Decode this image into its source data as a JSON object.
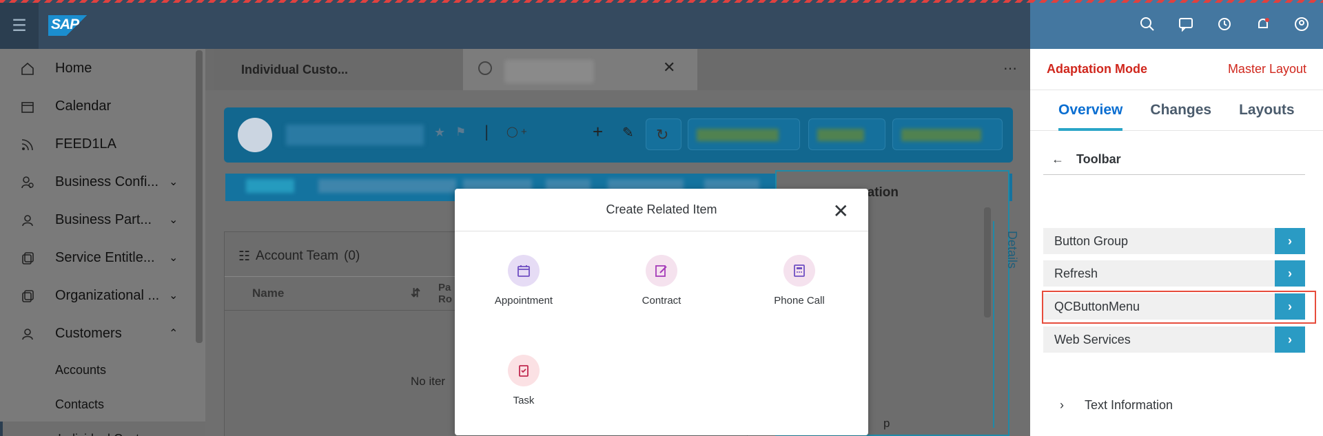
{
  "shell": {
    "logo": "SAP"
  },
  "sidebar": {
    "items": [
      {
        "label": "Home",
        "icon": "home-icon"
      },
      {
        "label": "Calendar",
        "icon": "calendar-icon"
      },
      {
        "label": "FEED1LA",
        "icon": "feed-icon"
      },
      {
        "label": "Business Confi...",
        "icon": "business-config-icon"
      },
      {
        "label": "Business Part...",
        "icon": "business-partner-icon"
      },
      {
        "label": "Service Entitle...",
        "icon": "service-entitlement-icon"
      },
      {
        "label": "Organizational ...",
        "icon": "organizational-icon"
      },
      {
        "label": "Customers",
        "icon": "customers-icon"
      }
    ],
    "sub_items": [
      "Accounts",
      "Contacts",
      "Individual Customers"
    ]
  },
  "tabs": {
    "tab1": "Individual Custo..."
  },
  "account_team": {
    "title": "Account Team",
    "count": "(0)",
    "col_name": "Name",
    "col_party": "Pa\nRo",
    "no_items": "No iter"
  },
  "info_panel": {
    "title": "nation",
    "partial": "p"
  },
  "details_label": "Details",
  "modal": {
    "title": "Create Related Item",
    "items": [
      {
        "label": "Appointment",
        "icon": "calendar-icon"
      },
      {
        "label": "Contract",
        "icon": "edit-document-icon"
      },
      {
        "label": "Phone Call",
        "icon": "phone-call-icon"
      },
      {
        "label": "Task",
        "icon": "task-icon"
      }
    ]
  },
  "adaptation": {
    "mode": "Adaptation Mode",
    "layout": "Master Layout",
    "tabs": [
      "Overview",
      "Changes",
      "Layouts"
    ],
    "section": "Toolbar",
    "items": [
      "Button Group",
      "Refresh",
      "QCButtonMenu",
      "Web Services"
    ],
    "text_information": "Text Information"
  }
}
